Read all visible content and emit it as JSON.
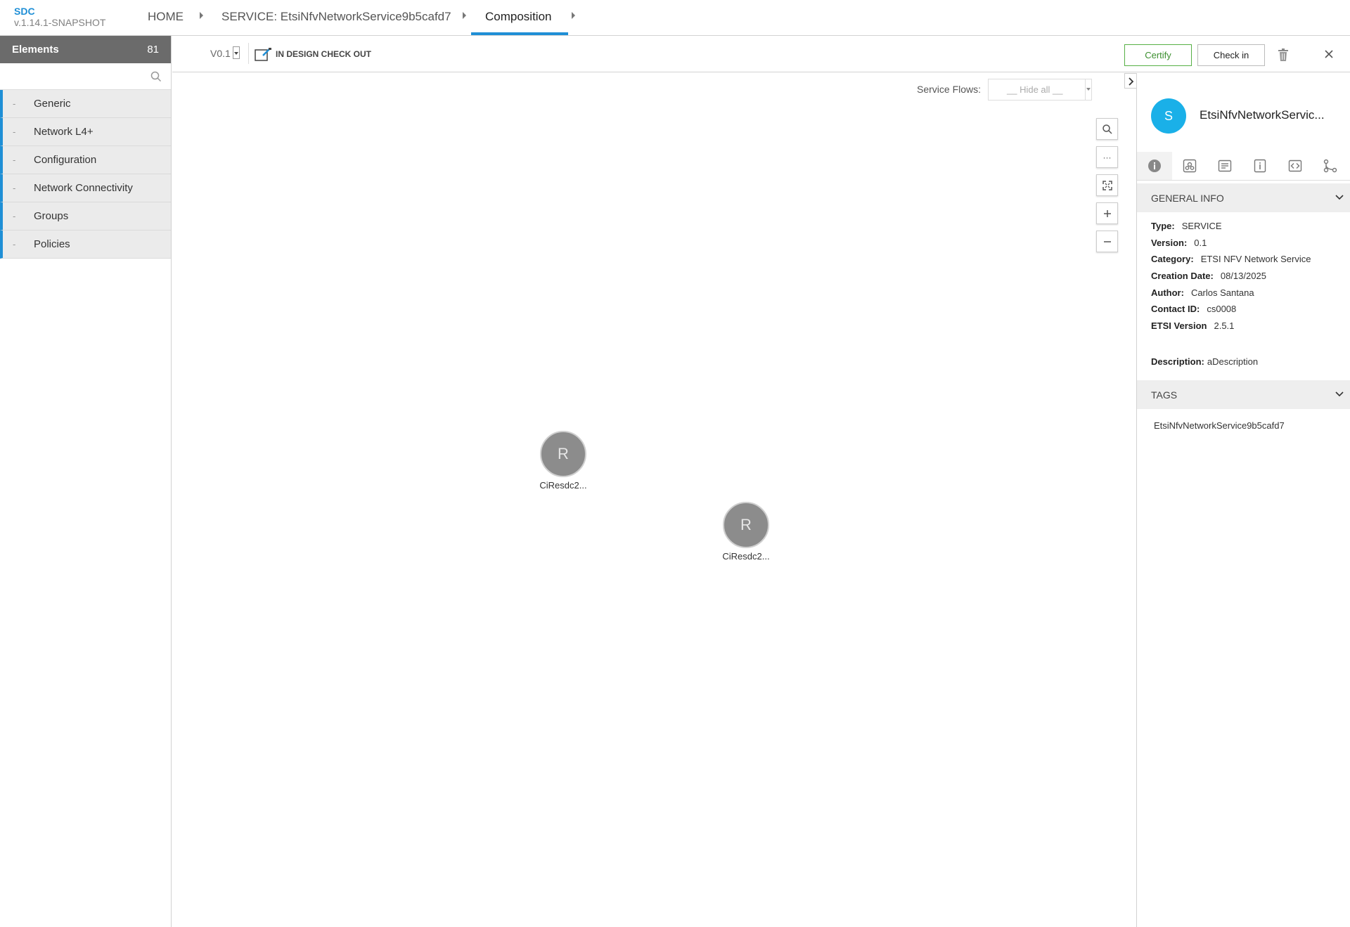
{
  "app": {
    "name": "SDC",
    "version": "v.1.14.1-SNAPSHOT"
  },
  "breadcrumb": {
    "home": "HOME",
    "service": "SERVICE: EtsiNfvNetworkService9b5cafd7",
    "current": "Composition"
  },
  "palette": {
    "title": "Elements",
    "count": "81",
    "search_placeholder": "",
    "groups": [
      {
        "dash": "-",
        "label": "Generic"
      },
      {
        "dash": "-",
        "label": "Network L4+"
      },
      {
        "dash": "-",
        "label": "Configuration"
      },
      {
        "dash": "-",
        "label": "Network Connectivity"
      },
      {
        "dash": "-",
        "label": "Groups"
      },
      {
        "dash": "-",
        "label": "Policies"
      }
    ]
  },
  "toolbar": {
    "version": "V0.1",
    "lifecycle": "IN DESIGN CHECK OUT",
    "certify_label": "Certify",
    "checkin_label": "Check in"
  },
  "canvas": {
    "service_flows_label": "Service Flows:",
    "service_flows_value": "__ Hide all __",
    "zoom_more_label": "···",
    "nodes": [
      {
        "initial": "R",
        "label": "CiResdc2..."
      },
      {
        "initial": "R",
        "label": "CiResdc2..."
      }
    ]
  },
  "details": {
    "avatar": "S",
    "title": "EtsiNfvNetworkServic...",
    "general_info_title": "GENERAL INFO",
    "fields": [
      {
        "label": "Type:",
        "value": "SERVICE"
      },
      {
        "label": "Version:",
        "value": "0.1"
      },
      {
        "label": "Category:",
        "value": "ETSI NFV Network Service"
      },
      {
        "label": "Creation Date:",
        "value": "08/13/2025"
      },
      {
        "label": "Author:",
        "value": "Carlos Santana"
      },
      {
        "label": "Contact ID:",
        "value": "cs0008"
      },
      {
        "label": "ETSI Version",
        "value": "2.5.1"
      }
    ],
    "description_label": "Description:",
    "description_value": "aDescription",
    "tags_title": "TAGS",
    "tags": [
      "EtsiNfvNetworkService9b5cafd7"
    ]
  },
  "colors": {
    "accent": "#1f8fd6",
    "certify": "#56b045",
    "avatar": "#1ab0e8",
    "node": "#8c8c8c"
  }
}
